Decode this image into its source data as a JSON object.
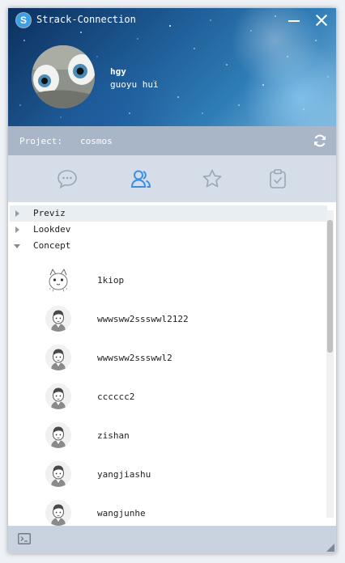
{
  "app": {
    "title": "Strack-Connection",
    "logo_letter": "S"
  },
  "user": {
    "username": "hgy",
    "full_name": "guoyu hui"
  },
  "project": {
    "label": "Project:",
    "name": "cosmos"
  },
  "tabs": [
    {
      "icon": "chat-bubble-icon",
      "active": false
    },
    {
      "icon": "users-icon",
      "active": true
    },
    {
      "icon": "star-icon",
      "active": false
    },
    {
      "icon": "clipboard-check-icon",
      "active": false
    }
  ],
  "tree": {
    "groups": [
      {
        "label": "Previz",
        "expanded": false,
        "selected": true
      },
      {
        "label": "Lookdev",
        "expanded": false,
        "selected": false
      },
      {
        "label": "Concept",
        "expanded": true,
        "selected": false
      }
    ],
    "members": [
      {
        "name": "1kiop",
        "avatar": "cat-sketch-avatar"
      },
      {
        "name": "wwwsww2ssswwl2122",
        "avatar": "default-avatar"
      },
      {
        "name": "wwwsww2ssswwl2",
        "avatar": "default-avatar"
      },
      {
        "name": "cccccc2",
        "avatar": "default-avatar"
      },
      {
        "name": "zishan",
        "avatar": "default-avatar"
      },
      {
        "name": "yangjiashu",
        "avatar": "default-avatar"
      },
      {
        "name": "wangjunhe",
        "avatar": "default-avatar"
      }
    ]
  },
  "colors": {
    "accent": "#3a8ee6",
    "tab_inactive": "#9aa6b5",
    "project_bar": "#a8b6c8",
    "tab_bar": "#d4dde8"
  }
}
